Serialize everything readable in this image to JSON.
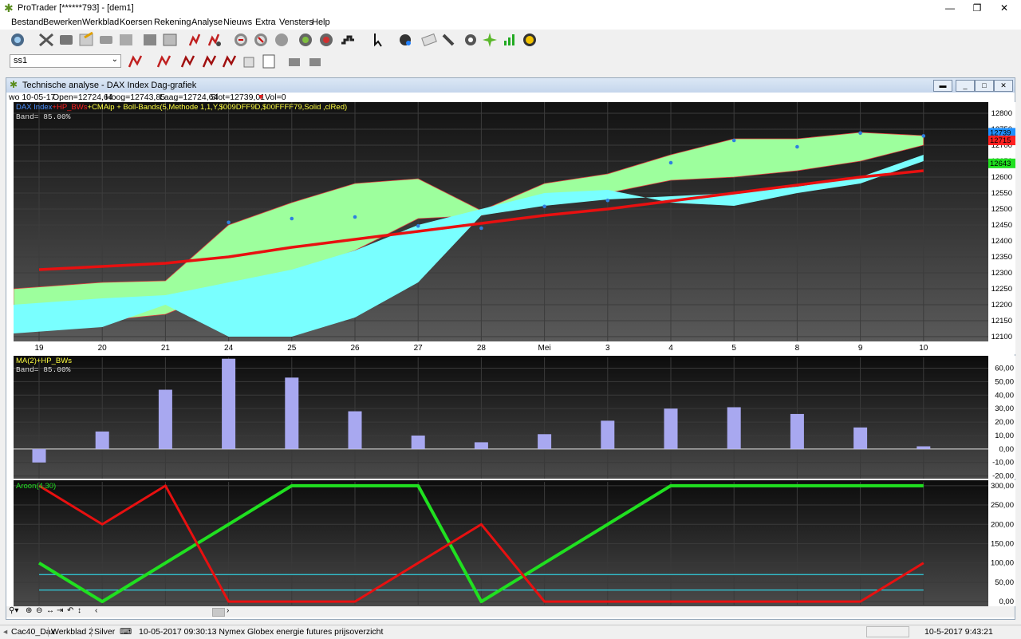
{
  "window": {
    "title": "ProTrader [******793] - [dem1]"
  },
  "menu": [
    "Bestand",
    "Bewerken",
    "Werkblad",
    "Koersen",
    "Rekening",
    "Analyse",
    "Nieuws",
    "Extra",
    "Vensters",
    "Help"
  ],
  "combo": {
    "value": "ss1"
  },
  "chart_window": {
    "title": "Technische analyse -  DAX Index Dag-grafiek",
    "info": {
      "date": "wo 10-05-17",
      "open": "Open=12724,64",
      "high": "Hoog=12743,85",
      "low": "Laag=12724,64",
      "close": "Slot=12739,01",
      "vol": "Vol=0"
    }
  },
  "price_panel": {
    "legend": [
      {
        "text": "DAX Index",
        "color": "#4a90ff"
      },
      {
        "text": "+HP_BWs",
        "color": "#ff2020"
      },
      {
        "text": "+CMAip + Boll-Bands(5,Methode 1,1,Y,$009DFF9D,$00FFFF79,Solid     ,clRed)",
        "color": "#ffff40"
      }
    ],
    "band_label": "Band=  85.00%",
    "badges": [
      {
        "text": "12739",
        "bg": "#1e90ff"
      },
      {
        "text": "12715",
        "bg": "#ff2020"
      },
      {
        "text": "12643",
        "bg": "#20e020"
      }
    ]
  },
  "osc_panel": {
    "legend": "MA(2)+HP_BWs",
    "band_label": "Band=  85.00%"
  },
  "aroon_panel": {
    "legend": "Aroon(4,30)"
  },
  "chart_data": [
    {
      "type": "line",
      "title": "DAX Index Dag-grafiek",
      "x": [
        "19",
        "20",
        "21",
        "24",
        "25",
        "26",
        "27",
        "28",
        "Mei",
        "3",
        "4",
        "5",
        "8",
        "9",
        "10"
      ],
      "yticks": [
        "12800",
        "12750",
        "12700",
        "12650",
        "12600",
        "12550",
        "12500",
        "12450",
        "12400",
        "12350",
        "12300",
        "12250",
        "12200",
        "12150",
        "12100"
      ],
      "ylim": [
        12085,
        12835
      ],
      "series": [
        {
          "name": "DAX Index",
          "kind": "points",
          "color": "#2e7fe0",
          "values": [
            null,
            null,
            null,
            12458,
            12470,
            12475,
            12447,
            12440,
            12508,
            12527,
            12645,
            12715,
            12695,
            12738,
            12729
          ]
        },
        {
          "name": "HP_BWs",
          "kind": "line",
          "color": "#e81010",
          "values": [
            12310,
            12320,
            12330,
            12350,
            12380,
            12405,
            12430,
            12455,
            12480,
            12500,
            12525,
            12550,
            12575,
            12600,
            12620
          ]
        },
        {
          "name": "band_upper",
          "values": [
            12250,
            12270,
            12275,
            12450,
            12520,
            12580,
            12595,
            12495,
            12580,
            12610,
            12670,
            12720,
            12720,
            12740,
            12730
          ]
        },
        {
          "name": "band_lower",
          "values": [
            12140,
            12150,
            12170,
            12250,
            12300,
            12370,
            12470,
            12480,
            12530,
            12550,
            12590,
            12600,
            12620,
            12650,
            12700
          ]
        },
        {
          "name": "cyan_upper",
          "values": [
            12200,
            12220,
            12230,
            12270,
            12310,
            12370,
            12450,
            12500,
            12550,
            12560,
            12520,
            12510,
            12550,
            12580,
            12650
          ]
        },
        {
          "name": "cyan_lower",
          "values": [
            12110,
            12130,
            12200,
            12100,
            12100,
            12160,
            12270,
            12480,
            12510,
            12530,
            12540,
            12550,
            12570,
            12600,
            12670
          ]
        }
      ]
    },
    {
      "type": "bar",
      "title": "MA(2)+HP_BWs",
      "categories": [
        "19",
        "20",
        "21",
        "24",
        "25",
        "26",
        "27",
        "28",
        "Mei",
        "3",
        "4",
        "5",
        "8",
        "9",
        "10"
      ],
      "values": [
        -10,
        13,
        44,
        67,
        53,
        28,
        10,
        5,
        11,
        21,
        30,
        31,
        26,
        16,
        2
      ],
      "yticks": [
        "60,00",
        "50,00",
        "40,00",
        "30,00",
        "20,00",
        "10,00",
        "0,00",
        "-10,00",
        "-20,00"
      ],
      "ylim": [
        -22,
        68
      ],
      "color": "#a8a8f0"
    },
    {
      "type": "line",
      "title": "Aroon(4,30)",
      "categories": [
        "19",
        "20",
        "21",
        "24",
        "25",
        "26",
        "27",
        "28",
        "Mei",
        "3",
        "4",
        "5",
        "8",
        "9",
        "10"
      ],
      "yticks": [
        "300,00",
        "250,00",
        "200,00",
        "150,00",
        "100,00",
        "50,00",
        "0,00"
      ],
      "ylim": [
        -8,
        310
      ],
      "series": [
        {
          "name": "Aroon up",
          "color": "#20e020",
          "values": [
            100,
            0,
            100,
            200,
            300,
            300,
            300,
            0,
            100,
            200,
            300,
            300,
            300,
            300,
            300
          ]
        },
        {
          "name": "Aroon down",
          "color": "#e81010",
          "values": [
            300,
            200,
            300,
            0,
            0,
            0,
            100,
            200,
            0,
            0,
            0,
            0,
            0,
            0,
            100
          ]
        }
      ],
      "hlines": [
        {
          "value": 70,
          "color": "#30d0e0"
        },
        {
          "value": 30,
          "color": "#30d0e0"
        }
      ]
    }
  ],
  "status": {
    "tab1": "Cac40_Dax",
    "tab2": "Werkblad 2",
    "tab3": "Silver",
    "news": "10-05-2017 09:30:13 Nymex Globex energie futures prijsoverzicht",
    "clock": "10-5-2017 9:43:21"
  }
}
